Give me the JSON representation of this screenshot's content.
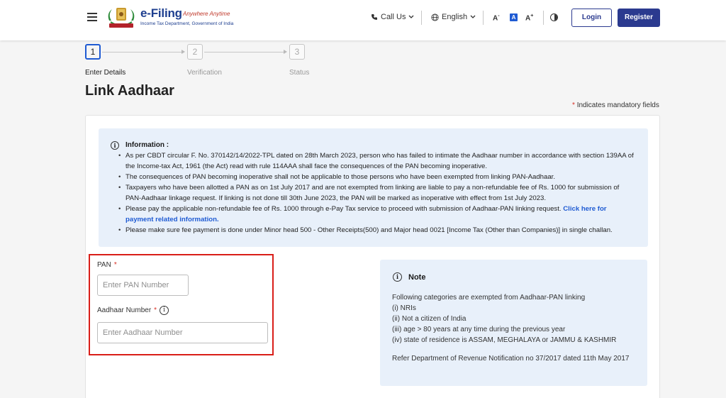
{
  "header": {
    "logo_title": "e-Filing",
    "logo_tagline": "Anywhere Anytime",
    "logo_subtitle": "Income Tax Department, Government of India",
    "call_us": "Call Us",
    "language": "English",
    "font_decrease": "A",
    "font_normal": "A",
    "font_increase": "A",
    "login": "Login",
    "register": "Register"
  },
  "stepper": [
    {
      "number": "1",
      "label": "Enter Details",
      "active": true
    },
    {
      "number": "2",
      "label": "Verification",
      "active": false
    },
    {
      "number": "3",
      "label": "Status",
      "active": false
    }
  ],
  "page": {
    "title": "Link Aadhaar",
    "mandatory_star": "*",
    "mandatory_text": "Indicates mandatory fields"
  },
  "info": {
    "title": "Information :",
    "items": [
      "As per CBDT circular F. No. 370142/14/2022-TPL dated on 28th March 2023, person who has failed to intimate the Aadhaar number in accordance with section 139AA of the Income-tax Act, 1961 (the Act) read with rule 114AAA shall face the consequences of the PAN becoming inoperative.",
      "The consequences of PAN becoming inoperative shall not be applicable to those persons who have been exempted from linking PAN-Aadhaar.",
      "Taxpayers who have been allotted a PAN as on 1st July 2017 and are not exempted from linking are liable to pay a non-refundable fee of Rs. 1000 for submission of PAN-Aadhaar linkage request. If linking is not done till 30th June 2023, the PAN will be marked as inoperative with effect from 1st July 2023.",
      "Please pay the applicable non-refundable fee of Rs. 1000 through e-Pay Tax service to proceed with submission of Aadhaar-PAN linking request.",
      "Please make sure fee payment is done under Minor head 500 - Other Receipts(500) and Major head 0021 [Income Tax (Other than Companies)] in single challan."
    ],
    "payment_link": "Click here for payment related information."
  },
  "form": {
    "pan_label": "PAN",
    "pan_star": "*",
    "pan_placeholder": "Enter PAN Number",
    "pan_value": "",
    "aadhaar_label": "Aadhaar Number",
    "aadhaar_star": "*",
    "aadhaar_placeholder": "Enter Aadhaar Number",
    "aadhaar_value": ""
  },
  "note": {
    "title": "Note",
    "intro": "Following categories are exempted from Aadhaar-PAN linking",
    "items": [
      "(i) NRIs",
      "(ii) Not a citizen of India",
      "(iii) age > 80 years at any time during the previous year",
      "(iv) state of residence is ASSAM, MEGHALAYA or JAMMU & KASHMIR"
    ],
    "reference": "Refer Department of Revenue Notification no 37/2017 dated 11th May 2017"
  },
  "colors": {
    "brand_blue": "#2b3a8f",
    "active_blue": "#1f5bd3",
    "info_bg": "#e8f0fa",
    "highlight_red": "#d91e18"
  }
}
